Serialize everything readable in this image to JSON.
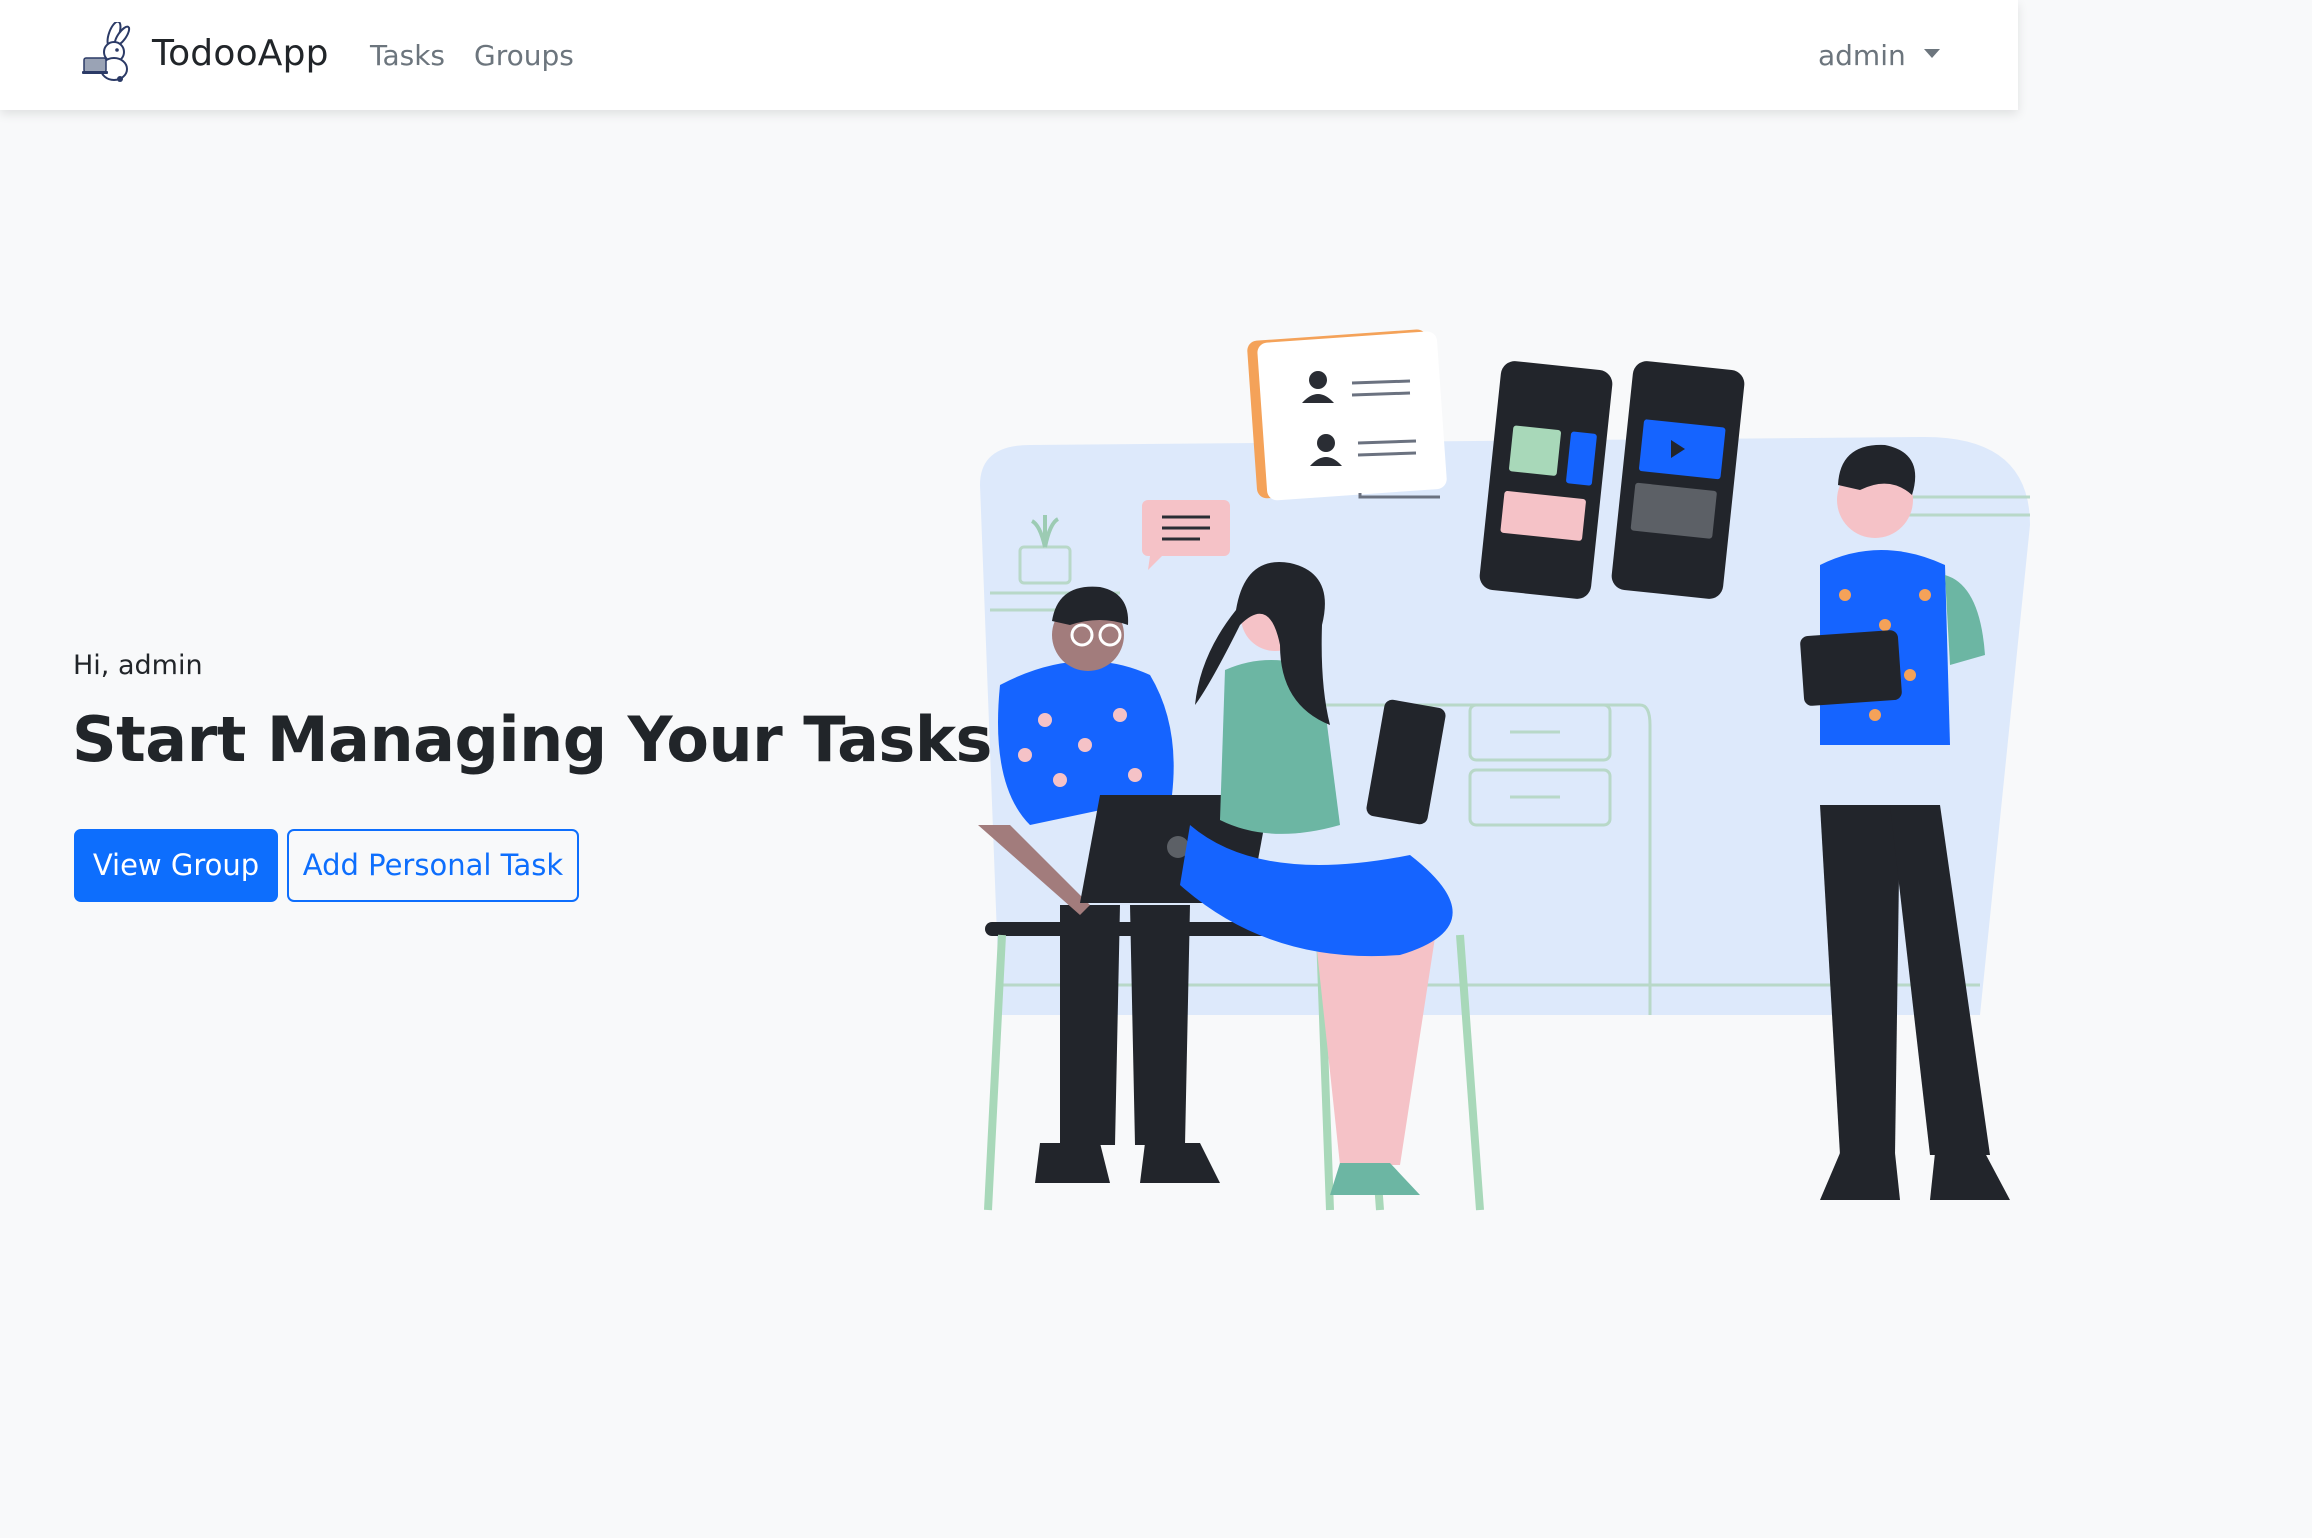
{
  "navbar": {
    "brand": "TodooApp",
    "links": [
      "Tasks",
      "Groups"
    ],
    "user": "admin"
  },
  "hero": {
    "greeting": "Hi, admin",
    "headline": "Start Managing Your Tasks",
    "primary_button": "View Group",
    "secondary_button": "Add Personal Task"
  },
  "colors": {
    "primary": "#0d6efd",
    "background": "#f8f9fa",
    "navbar": "#ffffff"
  }
}
